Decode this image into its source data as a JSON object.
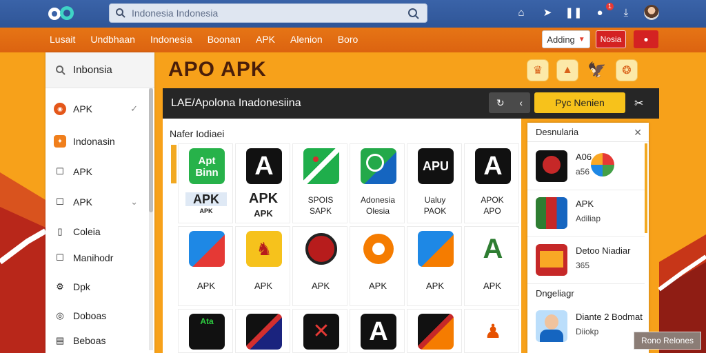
{
  "topbar": {
    "logo_text": "ap",
    "search_placeholder": "Indonesia Indonesia",
    "notification_count": "1"
  },
  "nav": {
    "items": [
      "Lusait",
      "Undbhaan",
      "Indonesia",
      "Boonan",
      "APK",
      "Alenion",
      "Boro"
    ],
    "dropdown_label": "Adding",
    "red_button_label": "Nosia"
  },
  "sidebar": {
    "search_label": "Inbonsia",
    "items": [
      {
        "label": "APK",
        "icon": "orange-circle-icon"
      },
      {
        "label": "Indonasin",
        "icon": "orange-app-icon"
      },
      {
        "label": "APK",
        "icon": "square-icon"
      },
      {
        "label": "APK",
        "icon": "square-icon"
      },
      {
        "label": "Coleia",
        "icon": "document-icon"
      },
      {
        "label": "Manihodr",
        "icon": "square-icon"
      },
      {
        "label": "Dpk",
        "icon": "gear-icon"
      },
      {
        "label": "Doboas",
        "icon": "circle-icon"
      },
      {
        "label": "Beboas",
        "icon": "document-icon"
      }
    ]
  },
  "header": {
    "title": "APO APK"
  },
  "mainbar": {
    "title": "LAE/Apolona Inadonesiina",
    "yellow_button": "Pyc Nenien"
  },
  "content": {
    "section_title": "Nafer Iodiaei",
    "row1": [
      {
        "tile_text": "Apt Binn",
        "label1": "APK",
        "label2": "APK"
      },
      {
        "tile_text": "A",
        "label1": "APK",
        "label2": "APK"
      },
      {
        "tile_text": "",
        "label1": "SPOIS",
        "label2": "SAPK"
      },
      {
        "tile_text": "",
        "label1": "Adonesia",
        "label2": "Olesia"
      },
      {
        "tile_text": "APU",
        "label1": "Ualuy",
        "label2": "PAOK"
      },
      {
        "tile_text": "A",
        "label1": "APOK",
        "label2": "APO"
      }
    ],
    "row2_label": "APK",
    "row3_tile_text": "Ata"
  },
  "right_panel": {
    "title": "Desnularia",
    "items": [
      {
        "title": "A06",
        "subtitle": "a56"
      },
      {
        "title": "APK",
        "subtitle": "Adiliap"
      },
      {
        "title": "Detoo Niadiar",
        "subtitle": "365"
      }
    ],
    "section_label": "Dngeliagr",
    "section_item": {
      "title": "Diante 2 Bodmat",
      "subtitle": "Diiokp"
    }
  },
  "bottom_button": "Rono Relones"
}
